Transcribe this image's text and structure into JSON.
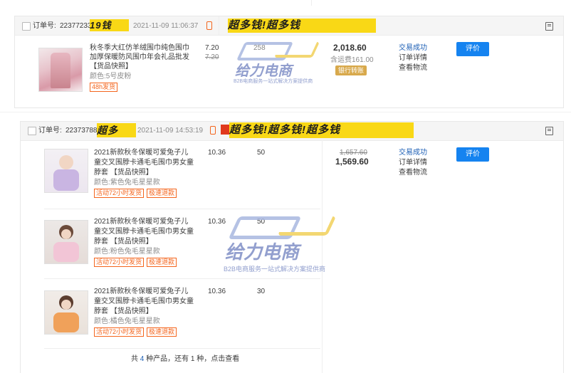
{
  "orders": [
    {
      "order_no_label": "订单号:",
      "order_no": "22377233",
      "banner_text": "19钱",
      "banner_text_right": "超多钱!超多钱",
      "time": "2021-11-09 11:06:37",
      "items": [
        {
          "title_lines": [
            "秋冬季大红仿羊绒围巾纯色围巾",
            "加厚保暖防风围巾年会礼品批发",
            "【货品快照】"
          ],
          "spec": "颜色:5号皮粉",
          "tags": [
            "48h发货"
          ],
          "price": "7.20",
          "orig_price": "7.20",
          "qty": "258"
        }
      ],
      "total": "2,018.60",
      "shipping": "含运费161.00",
      "pay_method": "银行转账",
      "status": "交易成功",
      "links": [
        "订单详情",
        "查看物流"
      ],
      "rate_label": "评价"
    },
    {
      "order_no_label": "订单号:",
      "order_no": "22373788",
      "banner_text": "超多",
      "banner_text_right": "超多钱!超多钱!超多钱",
      "time": "2021-11-09 14:53:19",
      "items": [
        {
          "title_lines": [
            "2021新款秋冬保暖可爱兔子儿",
            "童交叉围脖卡通毛毛围巾男女童",
            "脖套 【货品快照】"
          ],
          "spec": "颜色:紫色兔毛星星款",
          "tags": [
            "活动72小时发货",
            "极速退款"
          ],
          "price": "10.36",
          "qty": "50"
        },
        {
          "title_lines": [
            "2021新款秋冬保暖可爱兔子儿",
            "童交叉围脖卡通毛毛围巾男女童",
            "脖套 【货品快照】"
          ],
          "spec": "颜色:粉色兔毛星星款",
          "tags": [
            "活动72小时发货",
            "极速退款"
          ],
          "price": "10.36",
          "qty": "50"
        },
        {
          "title_lines": [
            "2021新款秋冬保暖可爱兔子儿",
            "童交叉围脖卡通毛毛围巾男女童",
            "脖套 【货品快照】"
          ],
          "spec": "颜色:橘色兔毛星星款",
          "tags": [
            "活动72小时发货",
            "极速退款"
          ],
          "price": "10.36",
          "qty": "30"
        }
      ],
      "orig_total": "1,657.60",
      "total": "1,569.60",
      "status": "交易成功",
      "links": [
        "订单详情",
        "查看物流"
      ],
      "rate_label": "评价",
      "footer_pre": "共",
      "footer_count": "4",
      "footer_mid": "种产品，还有",
      "footer_more": "1",
      "footer_post": "种，点击查看"
    }
  ],
  "watermark": {
    "logo": "GL",
    "title": "给力电商",
    "subtitle": "B2B电商服务一站式解决方案提供商"
  },
  "icons": {
    "mobile": "mobile-phone-icon",
    "note": "note-icon"
  },
  "colors": {
    "accent": "#1583f0",
    "orange": "#f4651d",
    "banner": "#f9d816",
    "pay": "#d8a94c"
  }
}
